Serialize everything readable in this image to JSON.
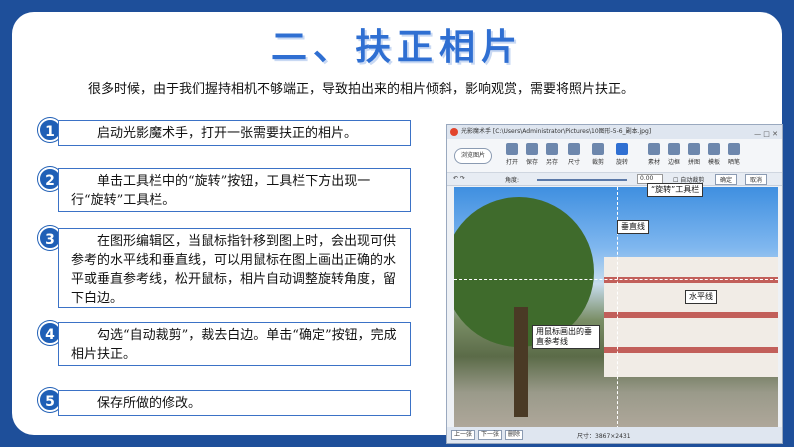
{
  "title": "二、扶正相片",
  "intro": "很多时候，由于我们握持相机不够端正，导致拍出来的相片倾斜，影响观赏，需要将照片扶正。",
  "steps": [
    {
      "num": "1",
      "text": "启动光影魔术手，打开一张需要扶正的相片。"
    },
    {
      "num": "2",
      "text": "单击工具栏中的“旋转”按钮，工具栏下方出现一行“旋转”工具栏。"
    },
    {
      "num": "3",
      "text": "在图形编辑区，当鼠标指针移到图上时，会出现可供参考的水平线和垂直线，可以用鼠标在图上画出正确的水平或垂直参考线，松开鼠标，相片自动调整旋转角度，留下白边。"
    },
    {
      "num": "4",
      "text": "勾选“自动裁剪”，裁去白边。单击“确定”按钮，完成相片扶正。"
    },
    {
      "num": "5",
      "text": "保存所做的修改。"
    }
  ],
  "screenshot": {
    "window_title": "光影魔术手 [C:\\Users\\Administrator\\Pictures\\10图形-5-6_副本.jpg]",
    "browse_label": "浏览图片",
    "toolbar": [
      "打开",
      "保存",
      "另存",
      "尺寸",
      "裁剪",
      "旋转",
      "素材",
      "边框",
      "拼图",
      "模板",
      "晒笔"
    ],
    "rotate_bar": {
      "angle_label": "角度:",
      "angle_value": "0.00",
      "auto_crop": "自动裁剪",
      "ok": "确定",
      "cancel": "取消"
    },
    "annotations": {
      "rotate_toolbar": "“旋转”工具栏",
      "vertical": "垂直线",
      "horizontal": "水平线",
      "drawn_line": "用鼠标画出的垂直参考线"
    },
    "statusbar": {
      "prev": "上一张",
      "next": "下一张",
      "delete": "删除",
      "size": "尺寸：3867×2431"
    }
  },
  "colors": {
    "frame": "#1e4f9a",
    "accent": "#2f6fd2",
    "number_badge": "#1f5fb6"
  }
}
